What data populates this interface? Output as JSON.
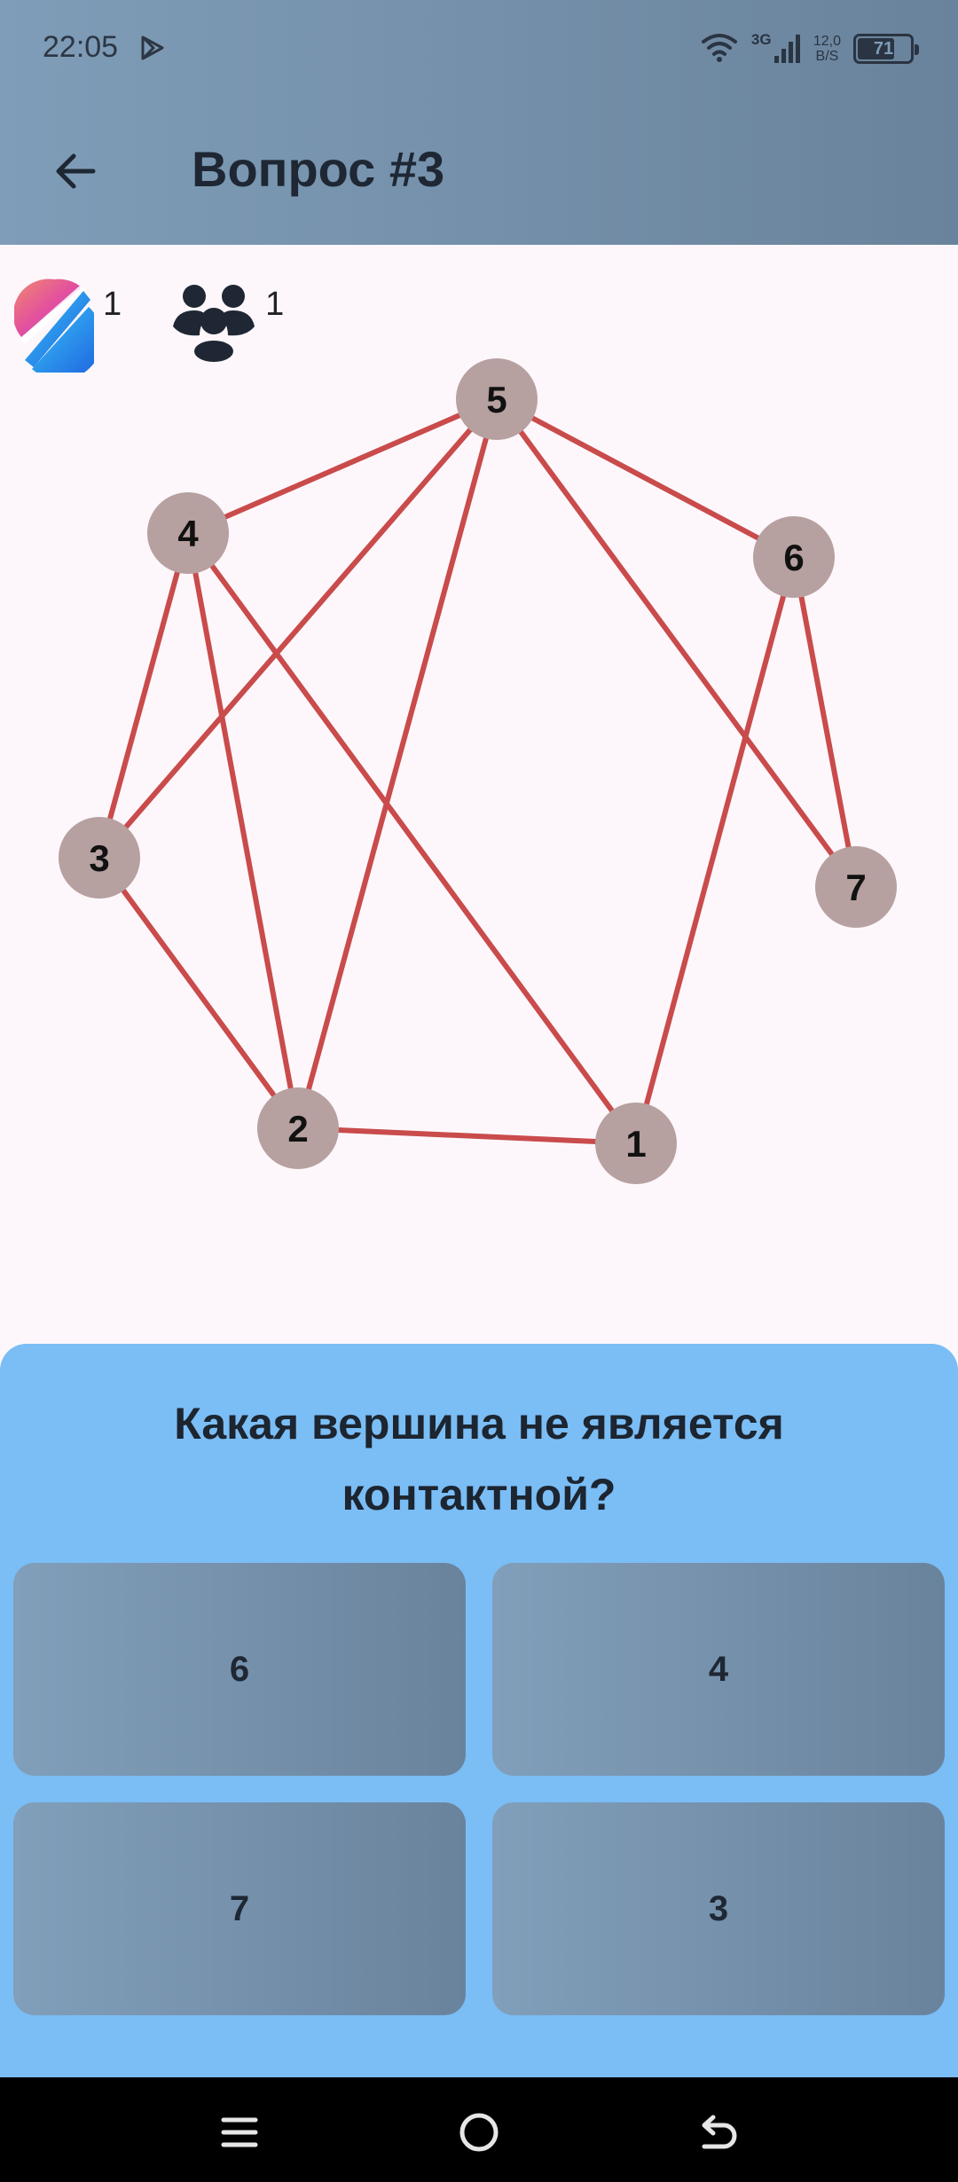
{
  "status_bar": {
    "time": "22:05",
    "network": "3G",
    "speed_value": "12,0",
    "speed_unit": "B/S",
    "battery": "71",
    "battery_level": 0.71
  },
  "app_bar": {
    "title": "Вопрос #3"
  },
  "scores": {
    "player_count": "1",
    "group_count": "1"
  },
  "graph": {
    "vertices": [
      {
        "label": "1"
      },
      {
        "label": "2"
      },
      {
        "label": "3"
      },
      {
        "label": "4"
      },
      {
        "label": "5"
      },
      {
        "label": "6"
      },
      {
        "label": "7"
      }
    ],
    "edges": [
      [
        "5",
        "4"
      ],
      [
        "5",
        "3"
      ],
      [
        "5",
        "2"
      ],
      [
        "5",
        "6"
      ],
      [
        "5",
        "7"
      ],
      [
        "4",
        "3"
      ],
      [
        "4",
        "2"
      ],
      [
        "4",
        "1"
      ],
      [
        "3",
        "2"
      ],
      [
        "2",
        "1"
      ],
      [
        "6",
        "1"
      ],
      [
        "6",
        "7"
      ]
    ],
    "colors": {
      "edge": "#c94b4b",
      "vertex": "#b7a0a0",
      "label": "#111111"
    }
  },
  "quiz": {
    "question": "Какая вершина не является контактной?",
    "answers": [
      "6",
      "4",
      "7",
      "3"
    ]
  },
  "colors": {
    "header": "#7694ae",
    "sheet": "#7bbdf5",
    "answer": "#7693ad"
  }
}
